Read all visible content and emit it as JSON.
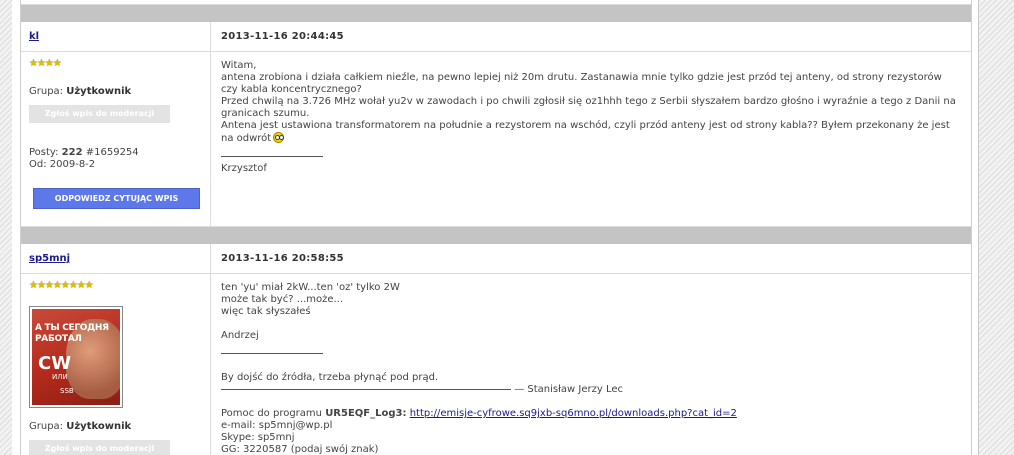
{
  "colors": {
    "separator": "#c4c4c4",
    "reply_button": "#5d78e8",
    "link": "#1a1a8c",
    "stars": "#d8c200"
  },
  "posts": [
    {
      "author": "kl",
      "stars": "★★★★",
      "group_label": "Grupa:",
      "group_value": "Użytkownik",
      "report_label": "Zgłoś wpis do moderacji",
      "stats_posts_label": "Posty:",
      "stats_posts_value": "222",
      "stats_post_id": "#1659254",
      "stats_since": "Od: 2009-8-2",
      "reply_label": "ODPOWIEDZ CYTUJĄC WPIS",
      "date": "2013-11-16 20:44:45",
      "body": [
        "Witam,",
        "antena zrobiona i działa całkiem nieźle, na pewno lepiej niż 20m drutu. Zastanawia mnie tylko gdzie jest przód tej anteny, od strony rezystorów czy kabla koncentrycznego?",
        "Przed chwilą na 3.726 MHz wołał yu2v w zawodach i po chwili zgłosił się oz1hhh tego z Serbii słyszałem bardzo głośno i wyraźnie a tego z Danii na granicach szumu.",
        "Antena jest ustawiona transformatorem na południe a rezystorem na wschód, czyli przód anteny jest od strony kabla?? Byłem przekonany że jest na odwrót"
      ],
      "signature": "Krzysztof"
    },
    {
      "author": "sp5mnj",
      "stars": "★★★★★★★★",
      "avatar_line1": "А ТЫ СЕГОДНЯ",
      "avatar_line2": "РАБОТАЛ",
      "avatar_cw": "CW",
      "avatar_ili": "ИЛИ",
      "avatar_ssb": "SSB",
      "group_label": "Grupa:",
      "group_value": "Użytkownik",
      "report_label": "Zgłoś wpis do moderacji",
      "date": "2013-11-16 20:58:55",
      "body": [
        "ten 'yu' miał 2kW...ten 'oz' tylko 2W",
        "może tak być? ...może...",
        "więc tak słyszałeś"
      ],
      "signature_name": "Andrzej",
      "quote": "By dojść do źródła, trzeba płynąć pod prąd.",
      "quote_author": "— Stanisław Jerzy Lec",
      "help_prefix": "Pomoc do programu",
      "help_program": "UR5EQF_Log3:",
      "help_link": "http://emisje-cyfrowe.sq9jxb-sq6mno.pl/downloads.php?cat_id=2",
      "email": "e-mail: sp5mnj@wp.pl",
      "skype": "Skype: sp5mnj",
      "gg": "GG: 3220587 (podaj swój znak)"
    }
  ]
}
